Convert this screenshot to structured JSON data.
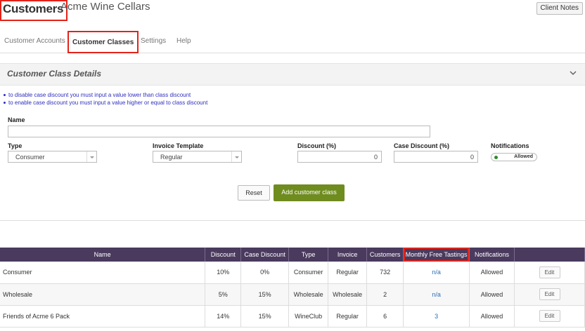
{
  "header": {
    "title": "Customers",
    "company": "Acme Wine Cellars",
    "client_notes_label": "Client Notes"
  },
  "tabs": [
    {
      "label": "Customer Accounts",
      "active": false
    },
    {
      "label": "Customer Classes",
      "active": true
    },
    {
      "label": "Settings",
      "active": false
    },
    {
      "label": "Help",
      "active": false
    }
  ],
  "section": {
    "title": "Customer Class Details",
    "notes": [
      "to disable case discount you must input a value lower than class discount",
      "to enable case discount you must input a value higher or equal to class discount"
    ]
  },
  "form": {
    "name_label": "Name",
    "name_value": "",
    "type_label": "Type",
    "type_value": "Consumer",
    "invoice_label": "Invoice Template",
    "invoice_value": "Regular",
    "discount_label": "Discount (%)",
    "discount_value": "0",
    "case_discount_label": "Case Discount (%)",
    "case_discount_value": "0",
    "notifications_label": "Notifications",
    "notifications_value": "Allowed",
    "reset_label": "Reset",
    "add_label": "Add customer class"
  },
  "table": {
    "columns": [
      "Name",
      "Discount",
      "Case Discount",
      "Type",
      "Invoice",
      "Customers",
      "Monthly Free Tastings",
      "Notifications",
      ""
    ],
    "rows": [
      {
        "name": "Consumer",
        "discount": "10%",
        "case_discount": "0%",
        "type": "Consumer",
        "invoice": "Regular",
        "customers": "732",
        "tastings": "n/a",
        "notifications": "Allowed",
        "action": "Edit"
      },
      {
        "name": "Wholesale",
        "discount": "5%",
        "case_discount": "15%",
        "type": "Wholesale",
        "invoice": "Wholesale",
        "customers": "2",
        "tastings": "n/a",
        "notifications": "Allowed",
        "action": "Edit"
      },
      {
        "name": "Friends of Acme 6 Pack",
        "discount": "14%",
        "case_discount": "15%",
        "type": "WineClub",
        "invoice": "Regular",
        "customers": "6",
        "tastings": "3",
        "notifications": "Allowed",
        "action": "Edit"
      }
    ]
  },
  "colors": {
    "accent_green": "#6f8c1f",
    "header_purple": "#4a3a5e",
    "highlight_red": "#e2231a",
    "link_blue": "#2d6fb6"
  }
}
